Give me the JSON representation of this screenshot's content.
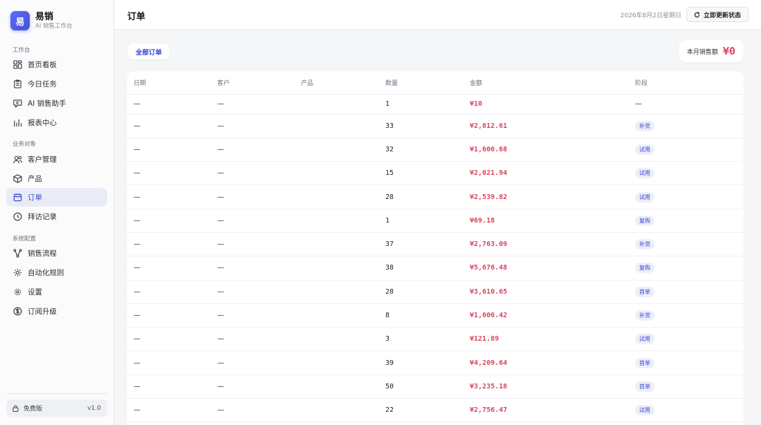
{
  "brand": {
    "logo_char": "易",
    "name": "易销",
    "subtitle": "AI 销售工作台"
  },
  "sidebar": {
    "sections": [
      {
        "label": "工作台"
      },
      {
        "label": "业务对象"
      },
      {
        "label": "系统配置"
      }
    ],
    "items": [
      {
        "label": "首页看板",
        "icon": "dashboard-icon"
      },
      {
        "label": "今日任务",
        "icon": "clipboard-icon"
      },
      {
        "label": "AI 销售助手",
        "icon": "chat-bot-icon"
      },
      {
        "label": "报表中心",
        "icon": "bar-chart-icon"
      },
      {
        "label": "客户管理",
        "icon": "users-icon"
      },
      {
        "label": "产品",
        "icon": "box-icon"
      },
      {
        "label": "订单",
        "icon": "calendar-icon",
        "active": true
      },
      {
        "label": "拜访记录",
        "icon": "clock-icon"
      },
      {
        "label": "销售流程",
        "icon": "flow-icon"
      },
      {
        "label": "自动化规则",
        "icon": "automation-icon"
      },
      {
        "label": "设置",
        "icon": "gear-icon"
      },
      {
        "label": "订阅升级",
        "icon": "dollar-icon"
      }
    ],
    "plan": {
      "label": "免费版",
      "version": "v1.0"
    }
  },
  "header": {
    "title": "订单",
    "date": "2026年8月2日星期日",
    "refresh_label": "立即更新状态"
  },
  "filter": {
    "label": "全部订单"
  },
  "sales": {
    "label": "本月销售额",
    "value": "¥0"
  },
  "table": {
    "columns": [
      "日期",
      "客户",
      "产品",
      "数量",
      "金额",
      "阶段"
    ],
    "rows": [
      {
        "date": "—",
        "customer": "—",
        "product": "",
        "qty": "1",
        "amount": "¥10",
        "stage": "—"
      },
      {
        "date": "—",
        "customer": "—",
        "product": "",
        "qty": "33",
        "amount": "¥2,812.61",
        "stage": "补货"
      },
      {
        "date": "—",
        "customer": "—",
        "product": "",
        "qty": "32",
        "amount": "¥1,606.68",
        "stage": "试用"
      },
      {
        "date": "—",
        "customer": "—",
        "product": "",
        "qty": "15",
        "amount": "¥2,021.94",
        "stage": "试用"
      },
      {
        "date": "—",
        "customer": "—",
        "product": "",
        "qty": "28",
        "amount": "¥2,539.82",
        "stage": "试用"
      },
      {
        "date": "—",
        "customer": "—",
        "product": "",
        "qty": "1",
        "amount": "¥69.18",
        "stage": "复购"
      },
      {
        "date": "—",
        "customer": "—",
        "product": "",
        "qty": "37",
        "amount": "¥2,763.09",
        "stage": "补货"
      },
      {
        "date": "—",
        "customer": "—",
        "product": "",
        "qty": "38",
        "amount": "¥5,676.48",
        "stage": "复购"
      },
      {
        "date": "—",
        "customer": "—",
        "product": "",
        "qty": "28",
        "amount": "¥3,610.65",
        "stage": "首单"
      },
      {
        "date": "—",
        "customer": "—",
        "product": "",
        "qty": "8",
        "amount": "¥1,006.42",
        "stage": "补货"
      },
      {
        "date": "—",
        "customer": "—",
        "product": "",
        "qty": "3",
        "amount": "¥121.89",
        "stage": "试用"
      },
      {
        "date": "—",
        "customer": "—",
        "product": "",
        "qty": "39",
        "amount": "¥4,209.64",
        "stage": "首单"
      },
      {
        "date": "—",
        "customer": "—",
        "product": "",
        "qty": "50",
        "amount": "¥3,235.18",
        "stage": "首单"
      },
      {
        "date": "—",
        "customer": "—",
        "product": "",
        "qty": "22",
        "amount": "¥2,756.47",
        "stage": "试用"
      }
    ]
  }
}
